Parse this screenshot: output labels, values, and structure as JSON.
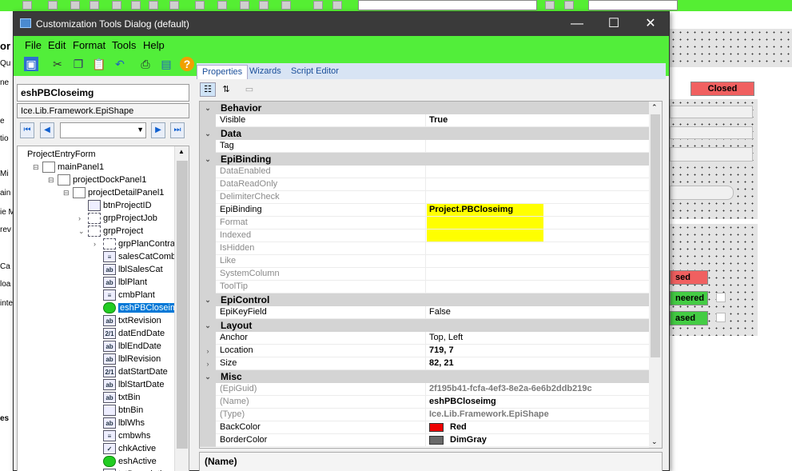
{
  "background_app": {
    "left_fragments": [
      "es",
      "or",
      "Qu",
      "ne",
      "e",
      "tio",
      "Mi",
      "ain",
      "ie M",
      "rev",
      "Ca",
      "loa",
      "inte",
      "es"
    ],
    "status_items": [
      {
        "label": "Closed",
        "color": "#f06060"
      },
      {
        "label": "sed",
        "color": "#f06060"
      },
      {
        "label": "neered",
        "color": "#44cc44"
      },
      {
        "label": "ased",
        "color": "#44cc44"
      }
    ]
  },
  "dialog": {
    "title": "Customization Tools Dialog (default)",
    "window_buttons": {
      "minimize": "—",
      "maximize": "☐",
      "close": "✕"
    },
    "menu": [
      "File",
      "Edit",
      "Format",
      "Tools",
      "Help"
    ],
    "toolbar_icons": [
      "save-icon",
      "cut-icon",
      "copy-icon",
      "paste-icon",
      "undo-icon",
      "print-icon",
      "preview-icon",
      "help-icon"
    ],
    "left": {
      "control_name": "eshPBCloseimg",
      "control_type": "Ice.Lib.Framework.EpiShape",
      "nav_buttons": [
        "⏮",
        "◀",
        "▶",
        "⏭"
      ],
      "tree": [
        {
          "label": "ProjectEntryForm",
          "level": 0,
          "icon": "form",
          "expander": ""
        },
        {
          "label": "mainPanel1",
          "level": 1,
          "icon": "panel",
          "expander": "⊟"
        },
        {
          "label": "projectDockPanel1",
          "level": 2,
          "icon": "panel",
          "expander": "⊟"
        },
        {
          "label": "projectDetailPanel1",
          "level": 3,
          "icon": "panel",
          "expander": "⊟"
        },
        {
          "label": "btnProjectID",
          "level": 4,
          "icon": "button",
          "expander": ""
        },
        {
          "label": "grpProjectJob",
          "level": 4,
          "icon": "grp",
          "expander": "›"
        },
        {
          "label": "grpProject",
          "level": 4,
          "icon": "grp",
          "expander": "⌄"
        },
        {
          "label": "grpPlanContrac",
          "level": 5,
          "icon": "grp",
          "expander": "›"
        },
        {
          "label": "salesCatCombo",
          "level": 5,
          "icon": "combo",
          "expander": ""
        },
        {
          "label": "lblSalesCat",
          "level": 5,
          "icon": "label",
          "expander": ""
        },
        {
          "label": "lblPlant",
          "level": 5,
          "icon": "label",
          "expander": ""
        },
        {
          "label": "cmbPlant",
          "level": 5,
          "icon": "combo",
          "expander": ""
        },
        {
          "label": "eshPBCloseimg",
          "level": 5,
          "icon": "shape",
          "expander": "",
          "selected": true
        },
        {
          "label": "txtRevision",
          "level": 5,
          "icon": "text",
          "expander": ""
        },
        {
          "label": "datEndDate",
          "level": 5,
          "icon": "date",
          "expander": ""
        },
        {
          "label": "lblEndDate",
          "level": 5,
          "icon": "label",
          "expander": ""
        },
        {
          "label": "lblRevision",
          "level": 5,
          "icon": "label",
          "expander": ""
        },
        {
          "label": "datStartDate",
          "level": 5,
          "icon": "date",
          "expander": ""
        },
        {
          "label": "lblStartDate",
          "level": 5,
          "icon": "label",
          "expander": ""
        },
        {
          "label": "txtBin",
          "level": 5,
          "icon": "text",
          "expander": ""
        },
        {
          "label": "btnBin",
          "level": 5,
          "icon": "button",
          "expander": ""
        },
        {
          "label": "lblWhs",
          "level": 5,
          "icon": "label",
          "expander": ""
        },
        {
          "label": "cmbwhs",
          "level": 5,
          "icon": "combo",
          "expander": ""
        },
        {
          "label": "chkActive",
          "level": 5,
          "icon": "check",
          "expander": ""
        },
        {
          "label": "eshActive",
          "level": 5,
          "icon": "shape",
          "expander": ""
        },
        {
          "label": "txtDescription",
          "level": 5,
          "icon": "text",
          "expander": ""
        }
      ]
    },
    "tabs": [
      "Properties",
      "Wizards",
      "Script Editor"
    ],
    "properties": [
      {
        "kind": "cat",
        "name": "Behavior"
      },
      {
        "name": "Visible",
        "value": "True",
        "bold": true
      },
      {
        "kind": "cat",
        "name": "Data"
      },
      {
        "name": "Tag",
        "value": ""
      },
      {
        "kind": "cat",
        "name": "EpiBinding"
      },
      {
        "name": "DataEnabled",
        "value": "",
        "gray": true
      },
      {
        "name": "DataReadOnly",
        "value": "",
        "gray": true
      },
      {
        "name": "DelimiterCheck",
        "value": "",
        "gray": true
      },
      {
        "name": "EpiBinding",
        "value": "Project.PBCloseimg",
        "bold": true
      },
      {
        "name": "Format",
        "value": "",
        "gray": true
      },
      {
        "name": "Indexed",
        "value": "",
        "gray": true
      },
      {
        "name": "IsHidden",
        "value": "",
        "gray": true
      },
      {
        "name": "Like",
        "value": "",
        "gray": true
      },
      {
        "name": "SystemColumn",
        "value": "",
        "gray": true
      },
      {
        "name": "ToolTip",
        "value": "",
        "gray": true
      },
      {
        "kind": "cat",
        "name": "EpiControl"
      },
      {
        "name": "EpiKeyField",
        "value": "False"
      },
      {
        "kind": "cat",
        "name": "Layout"
      },
      {
        "name": "Anchor",
        "value": "Top, Left"
      },
      {
        "name": "Location",
        "value": "719, 7",
        "bold": true,
        "expander": "›"
      },
      {
        "name": "Size",
        "value": "82, 21",
        "bold": true,
        "expander": "›"
      },
      {
        "kind": "cat",
        "name": "Misc"
      },
      {
        "name": "(EpiGuid)",
        "value": "2f195b41-fcfa-4ef3-8e2a-6e6b2ddb219c",
        "gray": true,
        "valgray": true,
        "bold": true
      },
      {
        "name": "(Name)",
        "value": "eshPBCloseimg",
        "gray": true,
        "bold": true
      },
      {
        "name": "(Type)",
        "value": "Ice.Lib.Framework.EpiShape",
        "gray": true,
        "valgray": true,
        "bold": true
      },
      {
        "name": "BackColor",
        "value": "Red",
        "bold": true,
        "swatch": "#ee0000"
      },
      {
        "name": "BorderColor",
        "value": "DimGray",
        "bold": true,
        "swatch": "#696969"
      }
    ],
    "help_title": "(Name)"
  }
}
